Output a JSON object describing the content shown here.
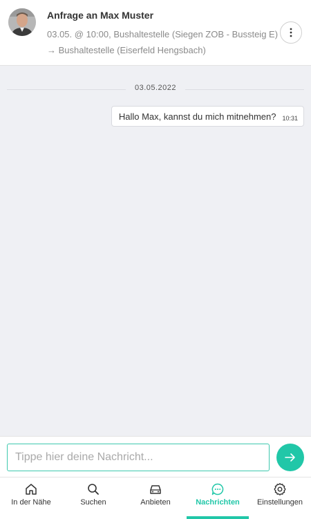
{
  "header": {
    "title": "Anfrage an Max Muster",
    "subtitle": "03.05. @ 10:00, Bushaltestelle (Siegen ZOB - Bussteig E) → Bushaltestelle (Eiserfeld Hengsbach)",
    "avatar_icon": "user-avatar-photo",
    "more_icon": "more-vertical-icon"
  },
  "chat": {
    "date_separator": "03.05.2022",
    "messages": [
      {
        "text": "Hallo Max, kannst du mich mitnehmen?",
        "time": "10:31",
        "direction": "outgoing"
      }
    ]
  },
  "composer": {
    "placeholder": "Tippe hier deine Nachricht...",
    "value": "",
    "send_icon": "arrow-right-icon"
  },
  "nav": {
    "items": [
      {
        "label": "In der Nähe",
        "icon": "home-icon",
        "active": false
      },
      {
        "label": "Suchen",
        "icon": "search-icon",
        "active": false
      },
      {
        "label": "Anbieten",
        "icon": "car-icon",
        "active": false
      },
      {
        "label": "Nachrichten",
        "icon": "chat-icon",
        "active": true
      },
      {
        "label": "Einstellungen",
        "icon": "gear-icon",
        "active": false
      }
    ]
  },
  "colors": {
    "accent": "#21c7a8",
    "chat_background": "#eff0f4",
    "input_border": "#3cc8ad"
  }
}
